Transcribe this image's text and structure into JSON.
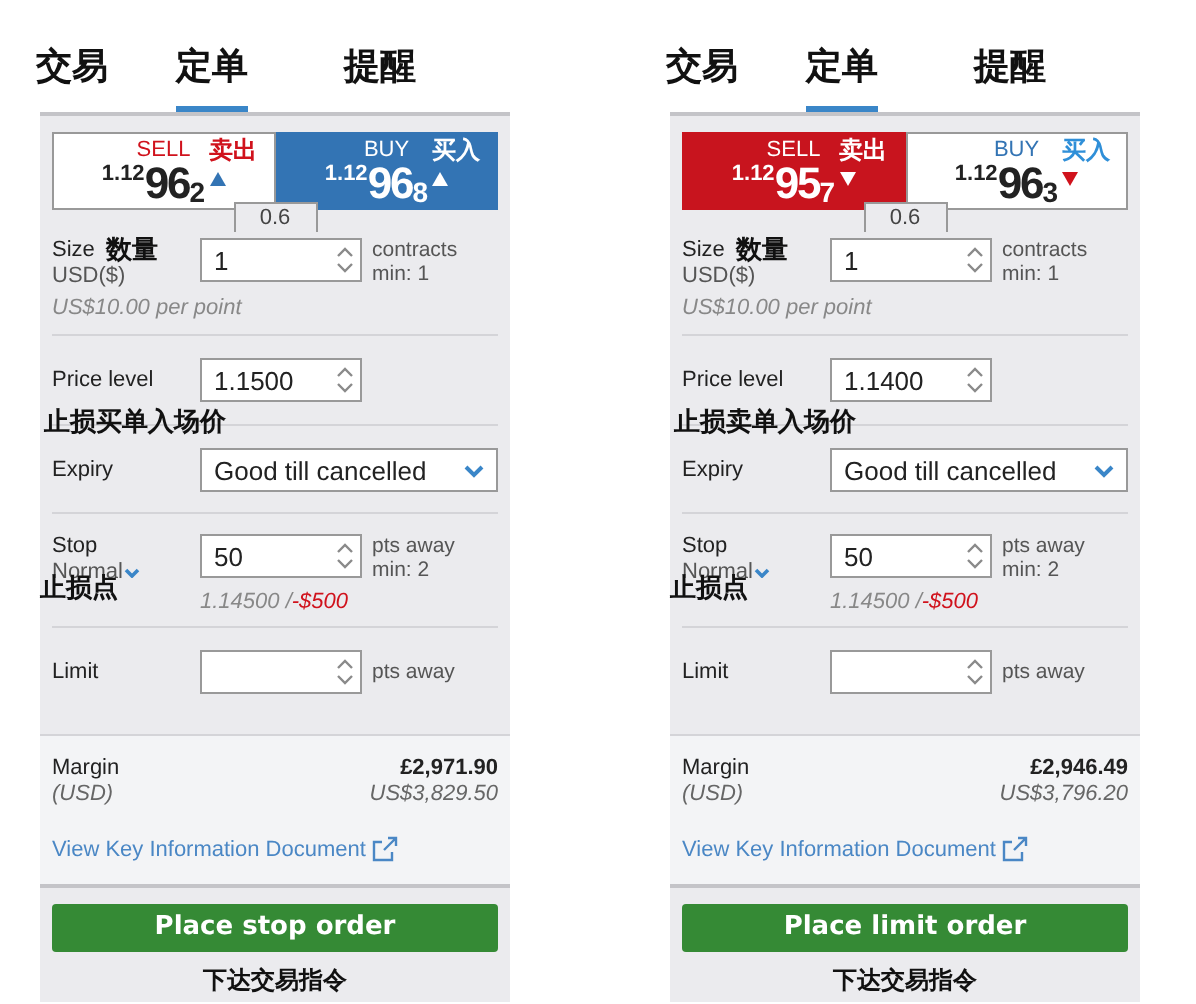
{
  "panels": [
    {
      "tabs": [
        {
          "label": "交易",
          "selected": false
        },
        {
          "label": "定单",
          "selected": true
        },
        {
          "label": "提醒",
          "selected": false
        }
      ],
      "sell": {
        "label": "SELL",
        "annotation": "卖出",
        "price_prefix": "1.12",
        "price_main": "96",
        "price_suffix": "2",
        "rising": true,
        "selected": false
      },
      "buy": {
        "label": "BUY",
        "annotation": "买入",
        "price_prefix": "1.12",
        "price_main": "96",
        "price_suffix": "8",
        "rising": true,
        "selected": true
      },
      "spread": "0.6",
      "size": {
        "label": "Size",
        "annotation": "数量",
        "currency": "USD($)",
        "value": "1",
        "unit": "contracts",
        "min": "min: 1",
        "per_point": "US$10.00 per point"
      },
      "price_level": {
        "label": "Price level",
        "value": "1.1500",
        "annotation": "止损买单入场价"
      },
      "expiry": {
        "label": "Expiry",
        "value": "Good till cancelled"
      },
      "stop": {
        "label": "Stop",
        "type": "Normal",
        "value": "50",
        "unit": "pts away",
        "min": "min: 2",
        "level_text": "1.14500 / ",
        "loss": "-$500",
        "annotation": "止损点"
      },
      "limit": {
        "label": "Limit",
        "unit": "pts away"
      },
      "margin": {
        "label": "Margin",
        "currency": "(USD)",
        "amount": "£2,971.90",
        "amount_usd": "US$3,829.50"
      },
      "link": "View Key Information Document",
      "button": "Place stop order",
      "button_annotation": "下达交易指令"
    },
    {
      "tabs": [
        {
          "label": "交易",
          "selected": false
        },
        {
          "label": "定单",
          "selected": true
        },
        {
          "label": "提醒",
          "selected": false
        }
      ],
      "sell": {
        "label": "SELL",
        "annotation": "卖出",
        "price_prefix": "1.12",
        "price_main": "95",
        "price_suffix": "7",
        "rising": false,
        "selected": true
      },
      "buy": {
        "label": "BUY",
        "annotation": "买入",
        "price_prefix": "1.12",
        "price_main": "96",
        "price_suffix": "3",
        "rising": false,
        "selected": false
      },
      "spread": "0.6",
      "size": {
        "label": "Size",
        "annotation": "数量",
        "currency": "USD($)",
        "value": "1",
        "unit": "contracts",
        "min": "min: 1",
        "per_point": "US$10.00 per point"
      },
      "price_level": {
        "label": "Price level",
        "value": "1.1400",
        "annotation": "止损卖单入场价"
      },
      "expiry": {
        "label": "Expiry",
        "value": "Good till cancelled"
      },
      "stop": {
        "label": "Stop",
        "type": "Normal",
        "value": "50",
        "unit": "pts away",
        "min": "min: 2",
        "level_text": "1.14500 / ",
        "loss": "-$500",
        "annotation": "止损点"
      },
      "limit": {
        "label": "Limit",
        "unit": "pts away"
      },
      "margin": {
        "label": "Margin",
        "currency": "(USD)",
        "amount": "£2,946.49",
        "amount_usd": "US$3,796.20"
      },
      "link": "View Key Information Document",
      "button": "Place limit order",
      "button_annotation": "下达交易指令"
    }
  ]
}
